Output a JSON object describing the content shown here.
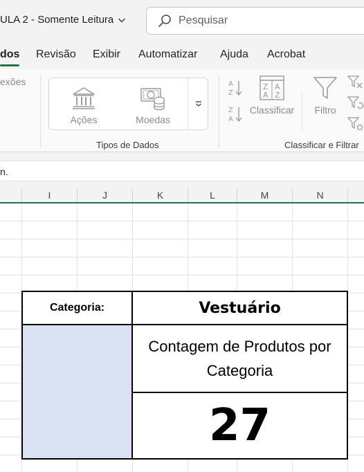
{
  "titlebar": {
    "file_title": "ULA 2  -  Somente Leitura",
    "search_placeholder": "Pesquisar"
  },
  "ribbon_tabs": [
    {
      "label": "dos",
      "active": true
    },
    {
      "label": "Revisão"
    },
    {
      "label": "Exibir"
    },
    {
      "label": "Automatizar"
    },
    {
      "label": "Ajuda"
    },
    {
      "label": "Acrobat"
    }
  ],
  "ribbon": {
    "cut_group_label": "exões",
    "data_types": {
      "acoes_label": "Ações",
      "moedas_label": "Moedas",
      "group_label": "Tipos de Dados"
    },
    "sort_filter": {
      "sort_label": "Classificar",
      "filter_label": "Filtro",
      "group_label": "Classificar e Filtrar"
    }
  },
  "formula_bar": {
    "text": "n."
  },
  "columns": [
    "I",
    "J",
    "K",
    "L",
    "M",
    "N"
  ],
  "dashboard": {
    "category_label": "Categoria:",
    "category_value": "Vestuário",
    "count_title": "Contagem de Produtos por Categoria",
    "count_value": "27",
    "slicer_color": "#d9e1f2"
  },
  "colors": {
    "accent": "#217346",
    "ribbon_bg": "#f3f3f3"
  }
}
